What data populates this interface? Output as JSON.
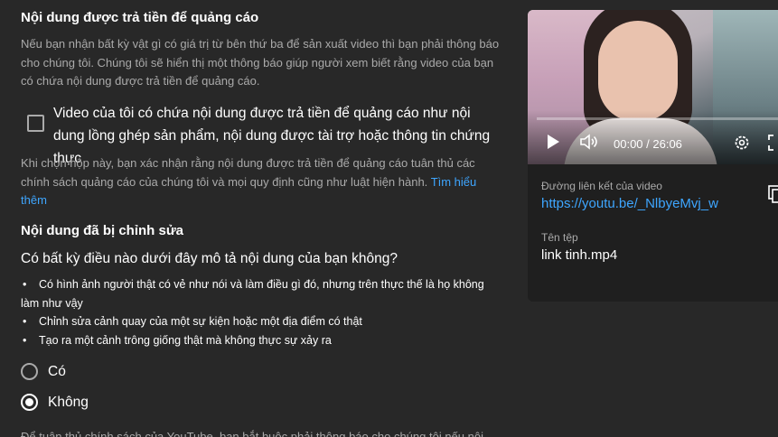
{
  "sponsored": {
    "title": "Nội dung được trả tiền để quảng cáo",
    "description": "Nếu bạn nhận bất kỳ vật gì có giá trị từ bên thứ ba để sản xuất video thì bạn phải thông báo cho chúng tôi. Chúng tôi sẽ hiển thị một thông báo giúp người xem biết rằng video của bạn có chứa nội dung được trả tiền để quảng cáo.",
    "checkbox_label": "Video của tôi có chứa nội dung được trả tiền để quảng cáo như nội dung lồng ghép sản phẩm, nội dung được tài trợ hoặc thông tin chứng thực",
    "checkbox_checked": false,
    "note": "Khi chọn hộp này, bạn xác nhận rằng nội dung được trả tiền để quảng cáo tuân thủ các chính sách quảng cáo của chúng tôi và mọi quy định cũng như luật hiện hành.",
    "learn_more": "Tìm hiểu thêm"
  },
  "altered": {
    "title": "Nội dung đã bị chỉnh sửa",
    "question": "Có bất kỳ điều nào dưới đây mô tả nội dung của bạn không?",
    "bullets": [
      "Có hình ảnh người thật có vẻ như nói và làm điều gì đó, nhưng trên thực thế là họ không",
      "làm như vậy",
      "Chỉnh sửa cảnh quay của một sự kiện hoặc một địa điểm có thật",
      "Tạo ra một cảnh trông giống thật mà không thực sự xảy ra"
    ],
    "options": [
      "Có",
      "Không"
    ],
    "selected": "Không",
    "cutoff_text": "Để tuân thủ chính sách của YouTube, bạn bắt buộc phải thông báo cho chúng tôi nếu nội"
  },
  "video": {
    "time": "00:00 / 26:06",
    "progress": 0,
    "link_label": "Đường liên kết của video",
    "link": "https://youtu.be/_NlbyeMvj_w",
    "filename_label": "Tên tệp",
    "filename": "link tinh.mp4"
  },
  "colors": {
    "background": "#282828",
    "card": "#1f1f1f",
    "link": "#3ea6ff",
    "muted": "#aaaaaa"
  }
}
